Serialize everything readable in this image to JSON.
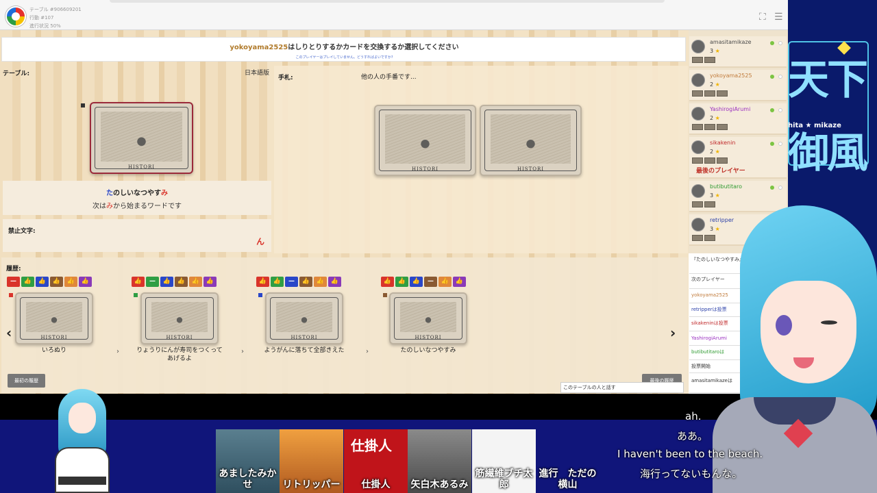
{
  "header": {
    "table_no": "テーブル #906609201",
    "action_no": "行動 #107",
    "progress": "進行状況 50%"
  },
  "prompt": {
    "player": "yokoyama2525",
    "message": "はしりとりするかカードを交換するか選択してください",
    "note": "このプレイヤーはプレイしていません。どうすればよいですか?"
  },
  "table": {
    "label": "テーブル:",
    "language": "日本語版",
    "word_first": "た",
    "word_middle": "のしいなつやす",
    "word_last": "み",
    "next_prefix": "次は",
    "next_char": "み",
    "next_suffix": "から始まるワードです",
    "banned_label": "禁止文字:",
    "banned_char": "ん",
    "card_brand": "HISTORI"
  },
  "hand": {
    "label": "手札:",
    "other": "他の人の手番です..."
  },
  "history": {
    "label": "履歴:",
    "items": [
      {
        "word": "いろぬり"
      },
      {
        "word": "りょうりにんが寿司をつくってあげるよ"
      },
      {
        "word": "ようがんに落ちて全部きえた"
      },
      {
        "word": "たのしいなつやすみ"
      }
    ],
    "first_btn": "最初の履歴",
    "last_btn": "最後の履歴"
  },
  "chat": {
    "placeholder": "このテーブルの人と話す"
  },
  "players": [
    {
      "name": "amasitamikaze",
      "score": "3",
      "color": "#4a4a4a"
    },
    {
      "name": "yokoyama2525",
      "score": "2",
      "color": "#c07a3a"
    },
    {
      "name": "YashirogiArumi",
      "score": "2",
      "color": "#9b30c0"
    },
    {
      "name": "sikakenin",
      "score": "2",
      "color": "#c0282a",
      "tag": "最後のプレイヤー"
    },
    {
      "name": "butibutitaro",
      "score": "3",
      "color": "#2e9a30"
    },
    {
      "name": "retripper",
      "score": "3",
      "color": "#2a3fa8"
    }
  ],
  "log": [
    "『たのしいなつやすみ』成功!",
    "次のプレイヤー",
    "yokoyama2525",
    "retripperは投票",
    "sikakeninは投票",
    "YashirogiArumi",
    "butibutitaroは",
    "投票開始",
    "amasitamikazeは"
  ],
  "stream": {
    "logo_line": "hita ★ mikaze",
    "participants": [
      {
        "name": "あましたみかせ"
      },
      {
        "name": "リトリッパー"
      },
      {
        "name": "仕掛人",
        "badge": "仕掛人"
      },
      {
        "name": "矢白木あるみ"
      },
      {
        "name": "筋繊維ブチ太郎"
      },
      {
        "name": "進行　ただの横山"
      }
    ],
    "subtitles": [
      "ah.",
      "ああ。",
      "I haven't been to the beach.",
      "海行ってないもんな。"
    ]
  },
  "colors": {
    "vote_red": "#d9342b",
    "vote_green": "#2f9e44",
    "vote_blue": "#2a47c8",
    "vote_brown": "#8a5a32",
    "vote_orange": "#e0883a",
    "vote_purple": "#8a3ab8"
  }
}
